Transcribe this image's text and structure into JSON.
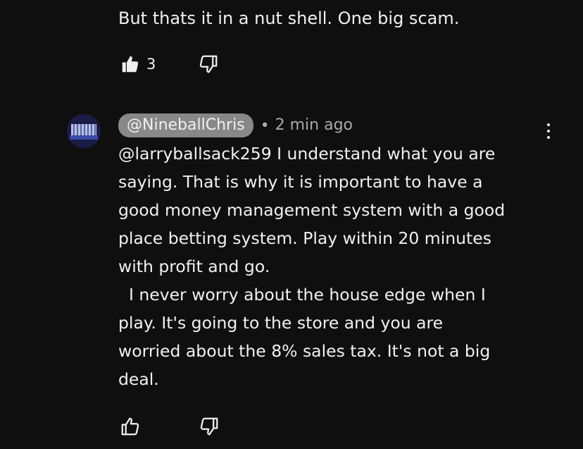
{
  "previous_comment": {
    "text_tail": "But thats it in a nut shell. One big scam.",
    "like_count": "3",
    "liked": true
  },
  "comment": {
    "author": "@NineballChris",
    "separator": "•",
    "time": "2 min ago",
    "lines": [
      "@larryballsack259 I understand what you are",
      "saying. That is why it is important to have a",
      "good money management system with a good",
      "place betting system. Play within 20 minutes",
      "with profit and go.",
      "  I never worry about the house edge when I",
      "play. It's going to the store and you are",
      "worried about the 8% sales tax. It's not a big",
      "deal."
    ]
  },
  "icons": {
    "like": "thumbs-up-icon",
    "dislike": "thumbs-down-icon",
    "more": "more-vert-icon"
  },
  "colors": {
    "background": "#0f0f0f",
    "text": "#f1f1f1",
    "secondary_text": "#aaaaaa",
    "author_chip": "#888888"
  }
}
